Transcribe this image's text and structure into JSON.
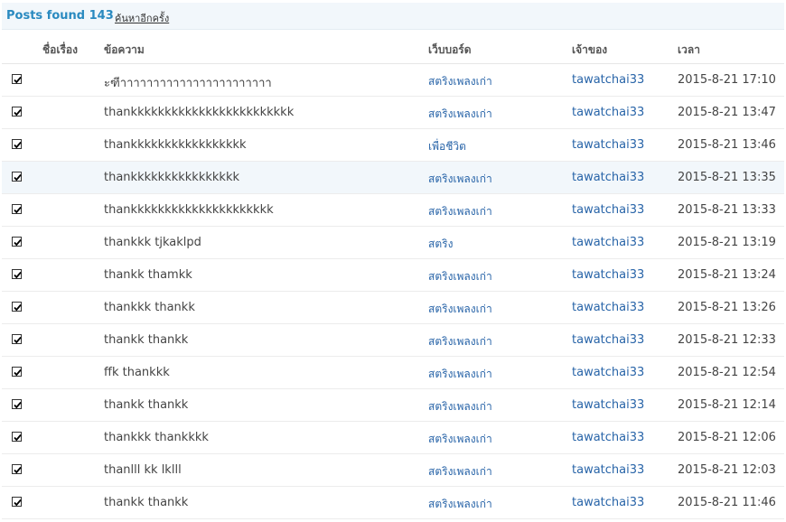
{
  "topbar": {
    "count_label": "Posts found 143",
    "search_again": "ค้นหาอีกครั้ง"
  },
  "headers": {
    "subject": "ชื่อเรื่อง",
    "message": "ข้อความ",
    "board": "เว็บบอร์ด",
    "owner": "เจ้าของ",
    "time": "เวลา"
  },
  "icons": {
    "checkbox": "checkbox-checked-icon"
  },
  "rows": [
    {
      "message": "ะฑีาาาาาาาาาาาาาาาาาาาาาาา",
      "board": "สตริงเพลงเก่า",
      "owner": "tawatchai33",
      "time": "2015-8-21 17:10"
    },
    {
      "message": "thankkkkkkkkkkkkkkkkkkkkkkkk",
      "board": "สตริงเพลงเก่า",
      "owner": "tawatchai33",
      "time": "2015-8-21 13:47"
    },
    {
      "message": "thankkkkkkkkkkkkkkkkk",
      "board": "เพื่อชีวิต",
      "owner": "tawatchai33",
      "time": "2015-8-21 13:46"
    },
    {
      "message": "thankkkkkkkkkkkkkkkk",
      "board": "สตริงเพลงเก่า",
      "owner": "tawatchai33",
      "time": "2015-8-21 13:35"
    },
    {
      "message": "thankkkkkkkkkkkkkkkkkkkkk",
      "board": "สตริงเพลงเก่า",
      "owner": "tawatchai33",
      "time": "2015-8-21 13:33"
    },
    {
      "message": "thankkk tjkaklpd",
      "board": "สตริง",
      "owner": "tawatchai33",
      "time": "2015-8-21 13:19"
    },
    {
      "message": "thankk thamkk",
      "board": "สตริงเพลงเก่า",
      "owner": "tawatchai33",
      "time": "2015-8-21 13:24"
    },
    {
      "message": "thankkk thankk",
      "board": "สตริงเพลงเก่า",
      "owner": "tawatchai33",
      "time": "2015-8-21 13:26"
    },
    {
      "message": "thankk thankk",
      "board": "สตริงเพลงเก่า",
      "owner": "tawatchai33",
      "time": "2015-8-21 12:33"
    },
    {
      "message": "ffk thankkk",
      "board": "สตริงเพลงเก่า",
      "owner": "tawatchai33",
      "time": "2015-8-21 12:54"
    },
    {
      "message": "thankk thankk",
      "board": "สตริงเพลงเก่า",
      "owner": "tawatchai33",
      "time": "2015-8-21 12:14"
    },
    {
      "message": "thankkk thankkkk",
      "board": "สตริงเพลงเก่า",
      "owner": "tawatchai33",
      "time": "2015-8-21 12:06"
    },
    {
      "message": "thanlll kk lklll",
      "board": "สตริงเพลงเก่า",
      "owner": "tawatchai33",
      "time": "2015-8-21 12:03"
    },
    {
      "message": "thankk thankk",
      "board": "สตริงเพลงเก่า",
      "owner": "tawatchai33",
      "time": "2015-8-21 11:46"
    }
  ]
}
